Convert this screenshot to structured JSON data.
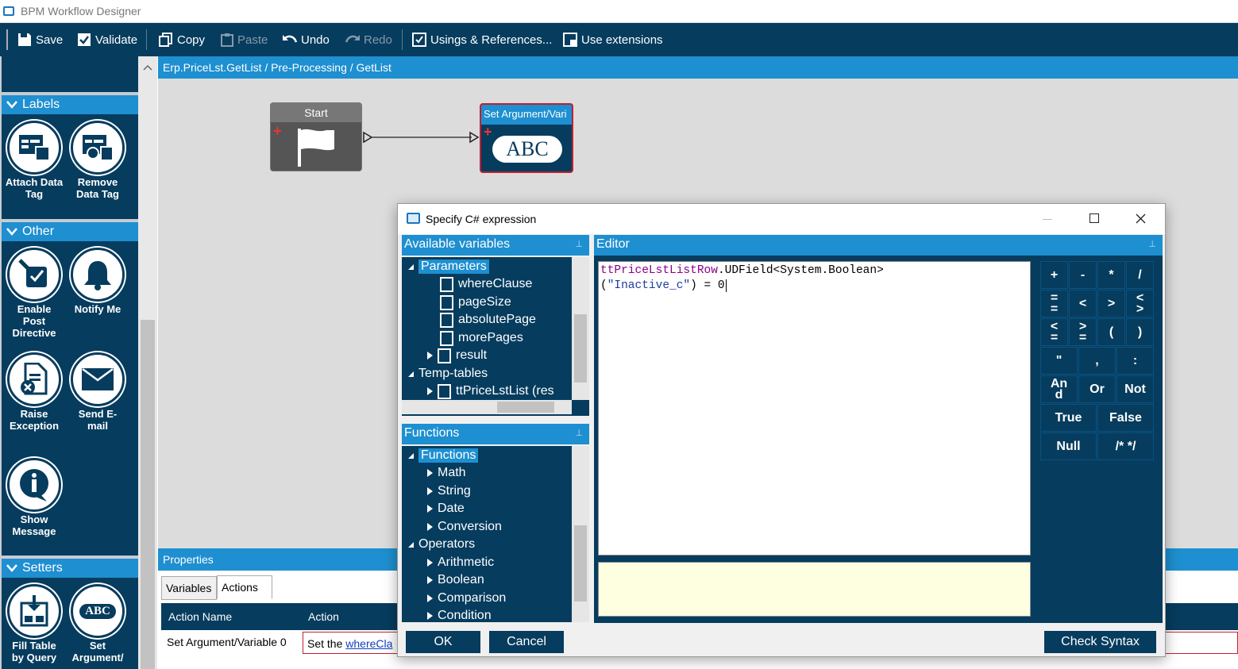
{
  "window": {
    "title": "BPM Workflow Designer"
  },
  "toolbar": {
    "save": "Save",
    "validate": "Validate",
    "copy": "Copy",
    "paste": "Paste",
    "undo": "Undo",
    "redo": "Redo",
    "usings": "Usings & References...",
    "extensions": "Use extensions"
  },
  "toolbox": {
    "sections": {
      "labels": "Labels",
      "other": "Other",
      "setters": "Setters"
    },
    "items": {
      "attach": "Attach Data Tag",
      "remove": "Remove Data Tag",
      "enable_l1": "Enable",
      "enable_l2": "Post",
      "enable_l3": "Directive",
      "notify": "Notify Me",
      "raise_l1": "Raise",
      "raise_l2": "Exception",
      "send_l1": "Send E-",
      "send_l2": "mail",
      "show_l1": "Show",
      "show_l2": "Message",
      "fill_l1": "Fill Table",
      "fill_l2": "by Query",
      "set_l1": "Set",
      "set_l2": "Argument/"
    }
  },
  "breadcrumb": "Erp.PriceLst.GetList / Pre-Processing / GetList",
  "nodes": {
    "start": "Start",
    "set_arg": "Set Argument/Vari",
    "abc": "ABC"
  },
  "properties": {
    "title": "Properties",
    "tabs": [
      "Variables",
      "Actions"
    ],
    "columns": [
      "Action Name",
      "Action"
    ],
    "row": {
      "name": "Set Argument/Variable 0",
      "action_prefix": "Set the ",
      "action_link": "whereCla"
    }
  },
  "dialog": {
    "title": "Specify C# expression",
    "available_variables": "Available variables",
    "editor": "Editor",
    "functions_title": "Functions",
    "variables": {
      "parameters": "Parameters",
      "params": [
        "whereClause",
        "pageSize",
        "absolutePage",
        "morePages",
        "result"
      ],
      "temp_tables": "Temp-tables",
      "temp_item": "ttPriceLstList (res"
    },
    "functions": {
      "root": "Functions",
      "children": [
        "Math",
        "String",
        "Date",
        "Conversion"
      ],
      "operators": "Operators",
      "op_children": [
        "Arithmetic",
        "Boolean",
        "Comparison",
        "Condition"
      ]
    },
    "code": {
      "line1_ident": "ttPriceLstListRow",
      "line1_rest": ".UDField<System.Boolean>",
      "line2_open": "(",
      "line2_str": "\"Inactive_c\"",
      "line2_rest": ") = 0"
    },
    "calc": {
      "plus": "+",
      "minus": "-",
      "times": "*",
      "div": "/",
      "eq_a": "=",
      "eq_b": "=",
      "lt": "<",
      "gt": ">",
      "le_a": "<",
      "le_b": ">",
      "lte_a": "<",
      "lte_b": "=",
      "gte_a": ">",
      "gte_b": "=",
      "lparen": "(",
      "rparen": ")",
      "quote": "\"",
      "comma": ",",
      "colon": ":",
      "and_a": "An",
      "and_b": "d",
      "or": "Or",
      "not": "Not",
      "true": "True",
      "false": "False",
      "null": "Null",
      "comment": "/* */"
    },
    "buttons": {
      "ok": "OK",
      "cancel": "Cancel",
      "check": "Check Syntax"
    }
  },
  "colors": {
    "navy": "#063c5e",
    "accent": "#1e8fd0"
  }
}
